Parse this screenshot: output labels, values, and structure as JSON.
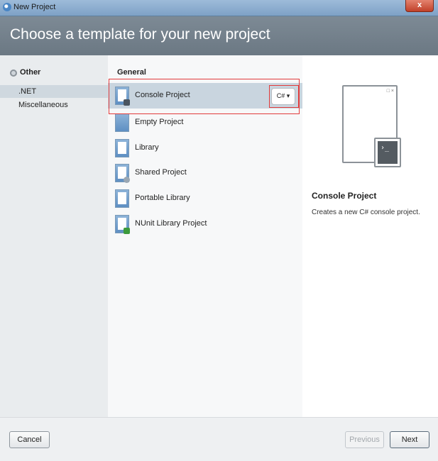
{
  "window": {
    "title": "New Project",
    "close_label": "x"
  },
  "header": {
    "title": "Choose a template for your new project"
  },
  "categories": {
    "heading": "Other",
    "items": [
      {
        "label": ".NET",
        "selected": true
      },
      {
        "label": "Miscellaneous",
        "selected": false
      }
    ]
  },
  "templates": {
    "heading": "General",
    "items": [
      {
        "label": "Console Project",
        "selected": true,
        "icon": "console-project-icon"
      },
      {
        "label": "Empty Project",
        "selected": false,
        "icon": "empty-project-icon"
      },
      {
        "label": "Library",
        "selected": false,
        "icon": "library-icon"
      },
      {
        "label": "Shared Project",
        "selected": false,
        "icon": "shared-project-icon"
      },
      {
        "label": "Portable Library",
        "selected": false,
        "icon": "portable-library-icon"
      },
      {
        "label": "NUnit Library Project",
        "selected": false,
        "icon": "nunit-library-icon"
      }
    ],
    "language": "C# ▾"
  },
  "preview": {
    "title": "Console Project",
    "description": "Creates a new C# console project.",
    "window_controls": "□ ×",
    "terminal_prompt": "›_"
  },
  "footer": {
    "cancel": "Cancel",
    "previous": "Previous",
    "next": "Next"
  },
  "colors": {
    "highlight": "#e23b3b",
    "header_bg": "#737f8a",
    "selected_row": "#c9d5df"
  }
}
